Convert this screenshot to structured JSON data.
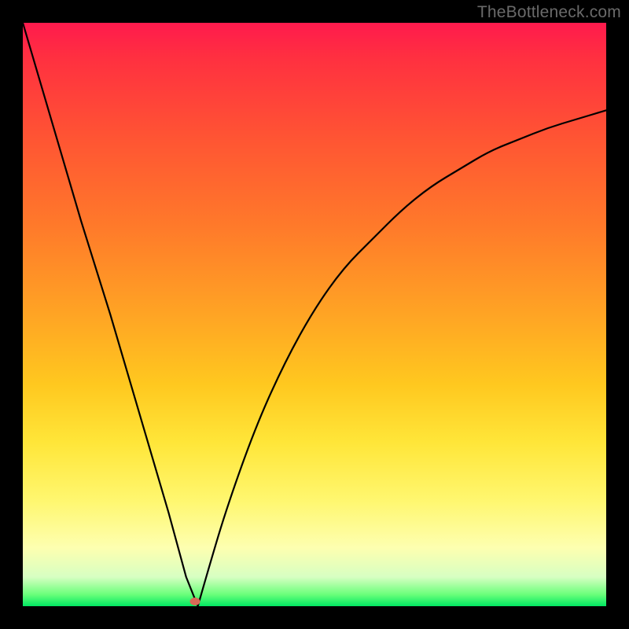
{
  "watermark": "TheBottleneck.com",
  "colors": {
    "border": "#000000",
    "curve": "#000000",
    "marker": "#d96a57",
    "gradient_top": "#ff1a4d",
    "gradient_bottom": "#00e862"
  },
  "chart_data": {
    "type": "line",
    "title": "",
    "xlabel": "",
    "ylabel": "",
    "xlim": [
      0,
      100
    ],
    "ylim": [
      0,
      100
    ],
    "left_segment": {
      "x": [
        0,
        5,
        10,
        15,
        20,
        25,
        28,
        30
      ],
      "y": [
        100,
        83,
        66,
        50,
        33,
        16,
        5,
        0
      ]
    },
    "right_segment": {
      "x": [
        30,
        32,
        35,
        40,
        45,
        50,
        55,
        60,
        65,
        70,
        75,
        80,
        85,
        90,
        95,
        100
      ],
      "y": [
        0,
        7,
        17,
        31,
        42,
        51,
        58,
        63,
        68,
        72,
        75,
        78,
        80,
        82,
        83.5,
        85
      ]
    },
    "marker": {
      "x": 29.5,
      "y": 0.8
    },
    "annotations": []
  }
}
